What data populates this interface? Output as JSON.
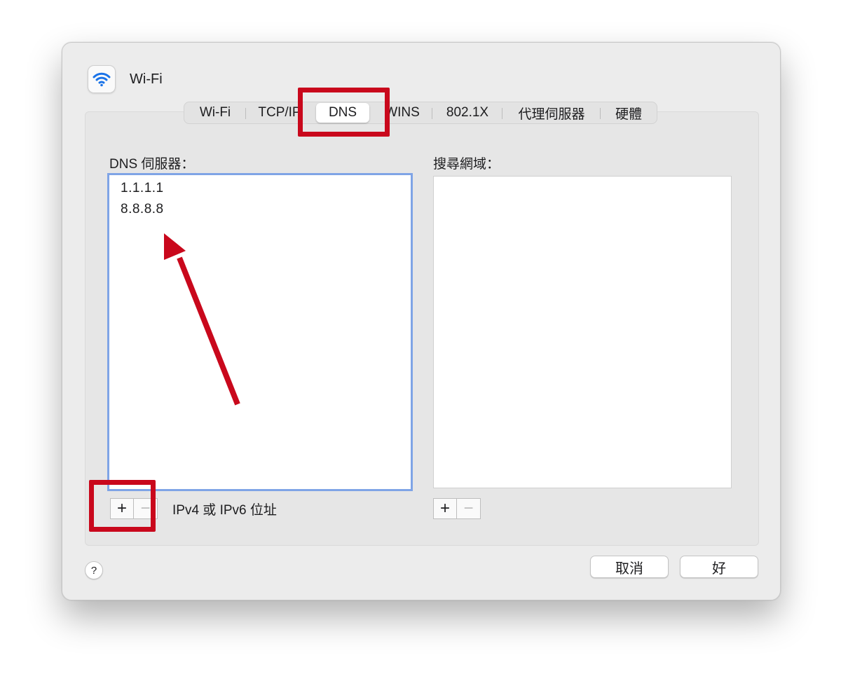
{
  "window": {
    "title": "Wi-Fi",
    "icon": "wifi-icon"
  },
  "tabs": [
    "Wi-Fi",
    "TCP/IP",
    "DNS",
    "WINS",
    "802.1X",
    "代理伺服器",
    "硬體"
  ],
  "active_tab": "DNS",
  "dns": {
    "label": "DNS 伺服器：",
    "servers": [
      "1.1.1.1",
      "8.8.8.8"
    ],
    "hint": "IPv4 或 IPv6 位址"
  },
  "search": {
    "label": "搜尋網域：",
    "domains": []
  },
  "buttons": {
    "add": "+",
    "remove": "−",
    "help": "?",
    "cancel": "取消",
    "ok": "好"
  },
  "annotation_color": "#c9081c"
}
